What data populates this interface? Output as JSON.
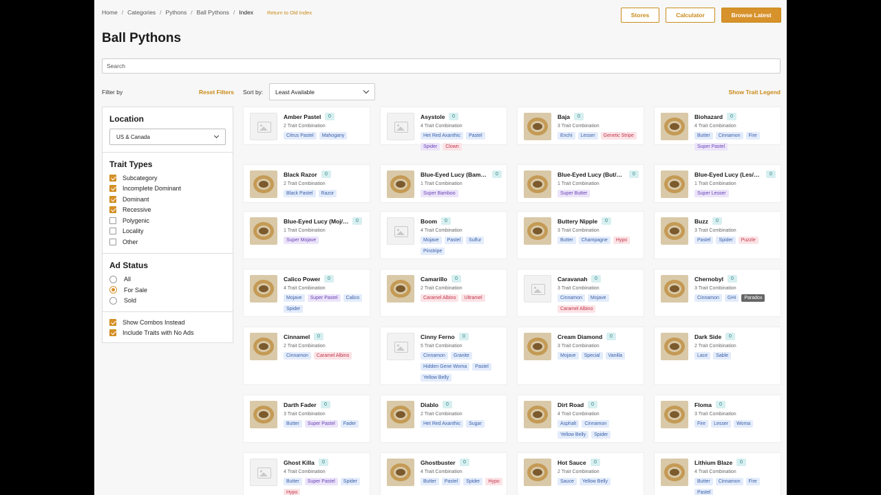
{
  "breadcrumb": [
    "Home",
    "Categories",
    "Pythons",
    "Ball Pythons",
    "Index"
  ],
  "return_old": "Return to Old Index",
  "buttons": {
    "stores": "Stores",
    "calculator": "Calculator",
    "browse": "Browse Latest"
  },
  "title": "Ball Pythons",
  "search": {
    "placeholder": "Search"
  },
  "filter_by": "Filter by",
  "reset_filters": "Reset Filters",
  "sort": {
    "label": "Sort by:",
    "value": "Least Available"
  },
  "show_trait_legend": "Show Trait Legend",
  "sidebar": {
    "location": {
      "title": "Location",
      "value": "US & Canada"
    },
    "trait_types": {
      "title": "Trait Types",
      "items": [
        {
          "label": "Subcategory",
          "checked": true
        },
        {
          "label": "Incomplete Dominant",
          "checked": true
        },
        {
          "label": "Dominant",
          "checked": true
        },
        {
          "label": "Recessive",
          "checked": true
        },
        {
          "label": "Polygenic",
          "checked": false
        },
        {
          "label": "Locality",
          "checked": false
        },
        {
          "label": "Other",
          "checked": false
        }
      ]
    },
    "ad_status": {
      "title": "Ad Status",
      "items": [
        {
          "label": "All",
          "selected": false
        },
        {
          "label": "For Sale",
          "selected": true
        },
        {
          "label": "Sold",
          "selected": false
        }
      ]
    },
    "extras": [
      {
        "label": "Show Combos Instead",
        "checked": true
      },
      {
        "label": "Include Traits with No Ads",
        "checked": true
      }
    ]
  },
  "cards": [
    {
      "name": "Amber Pastel",
      "count": "0",
      "combo": "2 Trait Combination",
      "photo": false,
      "tags": [
        {
          "t": "Citrus Pastel",
          "c": "blue"
        },
        {
          "t": "Mahogany",
          "c": "blue"
        }
      ]
    },
    {
      "name": "Asystole",
      "count": "0",
      "combo": "4 Trait Combination",
      "photo": false,
      "tags": [
        {
          "t": "Het Red Axanthic",
          "c": "blue"
        },
        {
          "t": "Pastel",
          "c": "blue"
        },
        {
          "t": "Spider",
          "c": "purple"
        },
        {
          "t": "Clown",
          "c": "red"
        }
      ]
    },
    {
      "name": "Baja",
      "count": "0",
      "combo": "3 Trait Combination",
      "photo": true,
      "tags": [
        {
          "t": "Enchi",
          "c": "blue"
        },
        {
          "t": "Lesser",
          "c": "blue"
        },
        {
          "t": "Genetic Stripe",
          "c": "red"
        }
      ]
    },
    {
      "name": "Biohazard",
      "count": "0",
      "combo": "4 Trait Combination",
      "photo": true,
      "tags": [
        {
          "t": "Butter",
          "c": "blue"
        },
        {
          "t": "Cinnamon",
          "c": "blue"
        },
        {
          "t": "Fire",
          "c": "blue"
        },
        {
          "t": "Super Pastel",
          "c": "purple"
        }
      ]
    },
    {
      "name": "Black Razor",
      "count": "0",
      "combo": "2 Trait Combination",
      "photo": true,
      "tags": [
        {
          "t": "Black Pastel",
          "c": "blue"
        },
        {
          "t": "Razor",
          "c": "blue"
        }
      ]
    },
    {
      "name": "Blue-Eyed Lucy (Bam/…",
      "count": "0",
      "combo": "1 Trait Combination",
      "photo": true,
      "tags": [
        {
          "t": "Super Bamboo",
          "c": "purple"
        }
      ]
    },
    {
      "name": "Blue-Eyed Lucy (But/B…",
      "count": "0",
      "combo": "1 Trait Combination",
      "photo": true,
      "tags": [
        {
          "t": "Super Butter",
          "c": "purple"
        }
      ]
    },
    {
      "name": "Blue-Eyed Lucy (Les/L…",
      "count": "0",
      "combo": "1 Trait Combination",
      "photo": true,
      "tags": [
        {
          "t": "Super Lesser",
          "c": "purple"
        }
      ]
    },
    {
      "name": "Blue-Eyed Lucy (Moj/…",
      "count": "0",
      "combo": "1 Trait Combination",
      "photo": true,
      "tags": [
        {
          "t": "Super Mojave",
          "c": "purple"
        }
      ]
    },
    {
      "name": "Boom",
      "count": "0",
      "combo": "4 Trait Combination",
      "photo": false,
      "tags": [
        {
          "t": "Mojave",
          "c": "blue"
        },
        {
          "t": "Pastel",
          "c": "blue"
        },
        {
          "t": "Sulfur",
          "c": "blue"
        },
        {
          "t": "Pinstripe",
          "c": "blue"
        }
      ]
    },
    {
      "name": "Buttery Nipple",
      "count": "0",
      "combo": "3 Trait Combination",
      "photo": true,
      "tags": [
        {
          "t": "Butter",
          "c": "blue"
        },
        {
          "t": "Champagne",
          "c": "blue"
        },
        {
          "t": "Hypo",
          "c": "red"
        }
      ]
    },
    {
      "name": "Buzz",
      "count": "0",
      "combo": "3 Trait Combination",
      "photo": true,
      "tags": [
        {
          "t": "Pastel",
          "c": "blue"
        },
        {
          "t": "Spider",
          "c": "blue"
        },
        {
          "t": "Puzzle",
          "c": "red"
        }
      ]
    },
    {
      "name": "Calico Power",
      "count": "0",
      "combo": "4 Trait Combination",
      "photo": true,
      "tags": [
        {
          "t": "Mojave",
          "c": "blue"
        },
        {
          "t": "Super Pastel",
          "c": "purple"
        },
        {
          "t": "Calico",
          "c": "blue"
        },
        {
          "t": "Spider",
          "c": "blue"
        }
      ]
    },
    {
      "name": "Camarillo",
      "count": "0",
      "combo": "2 Trait Combination",
      "photo": true,
      "tags": [
        {
          "t": "Caramel Albino",
          "c": "red"
        },
        {
          "t": "Ultramel",
          "c": "red"
        }
      ]
    },
    {
      "name": "Caravanah",
      "count": "0",
      "combo": "3 Trait Combination",
      "photo": false,
      "tags": [
        {
          "t": "Cinnamon",
          "c": "blue"
        },
        {
          "t": "Mojave",
          "c": "blue"
        },
        {
          "t": "Caramel Albino",
          "c": "red"
        }
      ]
    },
    {
      "name": "Chernobyl",
      "count": "0",
      "combo": "3 Trait Combination",
      "photo": true,
      "tags": [
        {
          "t": "Cinnamon",
          "c": "blue"
        },
        {
          "t": "GHI",
          "c": "blue"
        },
        {
          "t": "Paradox",
          "c": "dark"
        }
      ]
    },
    {
      "name": "Cinnamel",
      "count": "0",
      "combo": "2 Trait Combination",
      "photo": true,
      "tags": [
        {
          "t": "Cinnamon",
          "c": "blue"
        },
        {
          "t": "Caramel Albino",
          "c": "red"
        }
      ]
    },
    {
      "name": "Cinny Ferno",
      "count": "0",
      "combo": "5 Trait Combination",
      "photo": false,
      "tags": [
        {
          "t": "Cinnamon",
          "c": "blue"
        },
        {
          "t": "Granite",
          "c": "blue"
        },
        {
          "t": "Hidden Gene Woma",
          "c": "blue"
        },
        {
          "t": "Pastel",
          "c": "blue"
        },
        {
          "t": "Yellow Belly",
          "c": "blue"
        }
      ]
    },
    {
      "name": "Cream Diamond",
      "count": "0",
      "combo": "3 Trait Combination",
      "photo": true,
      "tags": [
        {
          "t": "Mojave",
          "c": "blue"
        },
        {
          "t": "Special",
          "c": "blue"
        },
        {
          "t": "Vanilla",
          "c": "blue"
        }
      ]
    },
    {
      "name": "Dark Side",
      "count": "0",
      "combo": "2 Trait Combination",
      "photo": true,
      "tags": [
        {
          "t": "Lace",
          "c": "blue"
        },
        {
          "t": "Sable",
          "c": "blue"
        }
      ]
    },
    {
      "name": "Darth Fader",
      "count": "0",
      "combo": "3 Trait Combination",
      "photo": true,
      "tags": [
        {
          "t": "Butter",
          "c": "blue"
        },
        {
          "t": "Super Pastel",
          "c": "purple"
        },
        {
          "t": "Fader",
          "c": "blue"
        }
      ]
    },
    {
      "name": "Diablo",
      "count": "0",
      "combo": "2 Trait Combination",
      "photo": true,
      "tags": [
        {
          "t": "Het Red Axanthic",
          "c": "blue"
        },
        {
          "t": "Sugar",
          "c": "blue"
        }
      ]
    },
    {
      "name": "Dirt Road",
      "count": "0",
      "combo": "4 Trait Combination",
      "photo": true,
      "tags": [
        {
          "t": "Asphalt",
          "c": "blue"
        },
        {
          "t": "Cinnamon",
          "c": "blue"
        },
        {
          "t": "Yellow Belly",
          "c": "blue"
        },
        {
          "t": "Spider",
          "c": "blue"
        }
      ]
    },
    {
      "name": "Floma",
      "count": "0",
      "combo": "3 Trait Combination",
      "photo": true,
      "tags": [
        {
          "t": "Fire",
          "c": "blue"
        },
        {
          "t": "Lesser",
          "c": "blue"
        },
        {
          "t": "Woma",
          "c": "blue"
        }
      ]
    },
    {
      "name": "Ghost Killa",
      "count": "0",
      "combo": "4 Trait Combination",
      "photo": false,
      "tags": [
        {
          "t": "Butter",
          "c": "blue"
        },
        {
          "t": "Super Pastel",
          "c": "purple"
        },
        {
          "t": "Spider",
          "c": "blue"
        },
        {
          "t": "Hypo",
          "c": "red"
        }
      ]
    },
    {
      "name": "Ghostbuster",
      "count": "0",
      "combo": "4 Trait Combination",
      "photo": true,
      "tags": [
        {
          "t": "Butter",
          "c": "blue"
        },
        {
          "t": "Pastel",
          "c": "blue"
        },
        {
          "t": "Spider",
          "c": "blue"
        },
        {
          "t": "Hypo",
          "c": "red"
        }
      ]
    },
    {
      "name": "Hot Sauce",
      "count": "0",
      "combo": "2 Trait Combination",
      "photo": true,
      "tags": [
        {
          "t": "Sauce",
          "c": "blue"
        },
        {
          "t": "Yellow Belly",
          "c": "blue"
        }
      ]
    },
    {
      "name": "Lithium Blaze",
      "count": "0",
      "combo": "4 Trait Combination",
      "photo": true,
      "tags": [
        {
          "t": "Butter",
          "c": "blue"
        },
        {
          "t": "Cinnamon",
          "c": "blue"
        },
        {
          "t": "Fire",
          "c": "blue"
        },
        {
          "t": "Pastel",
          "c": "blue"
        }
      ]
    }
  ]
}
